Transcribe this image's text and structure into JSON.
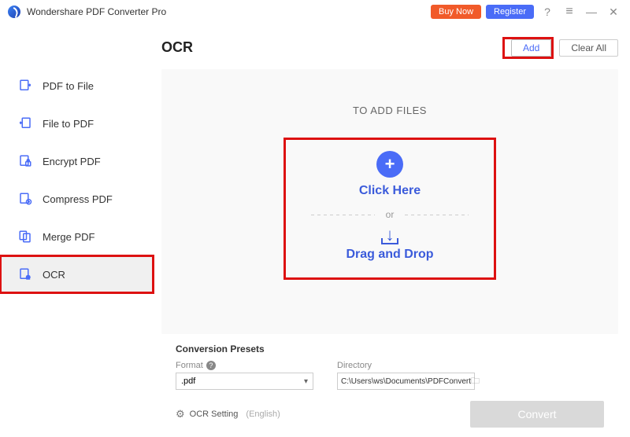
{
  "app": {
    "title": "Wondershare PDF Converter Pro"
  },
  "titlebar": {
    "buy": "Buy Now",
    "register": "Register"
  },
  "sidebar": {
    "items": [
      {
        "label": "PDF to File"
      },
      {
        "label": "File to PDF"
      },
      {
        "label": "Encrypt PDF"
      },
      {
        "label": "Compress PDF"
      },
      {
        "label": "Merge PDF"
      },
      {
        "label": "OCR"
      }
    ]
  },
  "main": {
    "title": "OCR",
    "add": "Add",
    "clear": "Clear All",
    "to_add": "TO ADD FILES",
    "click_here": "Click Here",
    "or": "or",
    "drag_drop": "Drag and Drop"
  },
  "presets": {
    "heading": "Conversion Presets",
    "format_label": "Format",
    "format_value": ".pdf",
    "dir_label": "Directory",
    "dir_value": "C:\\Users\\ws\\Documents\\PDFConvert"
  },
  "bottom": {
    "ocr_setting": "OCR Setting",
    "lang": "(English)",
    "convert": "Convert"
  }
}
